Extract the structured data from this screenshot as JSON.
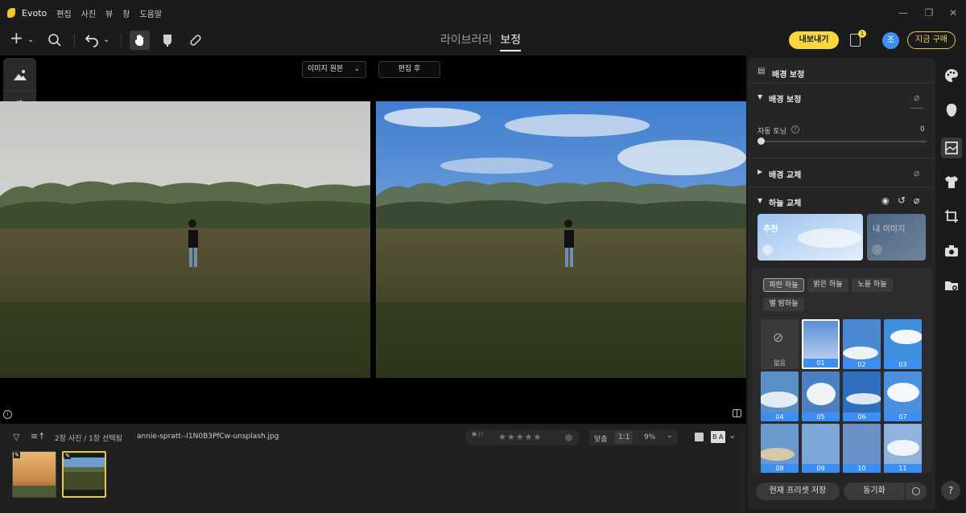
{
  "titlebar": {
    "app_name": "Evoto",
    "menus": [
      "편집",
      "사진",
      "뷰",
      "창",
      "도움말"
    ],
    "window_buttons": [
      "minimize-icon",
      "restore-icon",
      "close-icon"
    ]
  },
  "toolbar": {
    "tabs": {
      "library": "라이브러리",
      "edit": "보정"
    },
    "export_label": "내보내기",
    "notification_count": "1",
    "avatar_initial": "조",
    "buy_label": "지금 구매"
  },
  "canvas": {
    "view_select": "이미지 원본",
    "after_label": "편집 후"
  },
  "filmstrip": {
    "count_text": "2장 사진 / 1장 선택됨",
    "filename": "annie-spratt--l1N0B3PfCw-unsplash.jpg",
    "zoom_fit": "맞춤",
    "zoom_one": "1:1",
    "zoom_percent": "9%",
    "ba_label": "B A"
  },
  "panel": {
    "title": "배경 보정",
    "section_bg": "배경 보정",
    "auto_toning_label": "자동 토닝",
    "auto_toning_value": "0",
    "section_replace": "배경 교체",
    "section_sky": "하늘 교체",
    "sky_cards": {
      "recommended": "추천",
      "mine": "내 이미지"
    },
    "sky_tabs": [
      "파란 하늘",
      "밝은 하늘",
      "노을 하늘",
      "별 밤하늘"
    ],
    "sky_none": "없음",
    "sky_items": [
      "01",
      "02",
      "03",
      "04",
      "05",
      "06",
      "07",
      "08",
      "09",
      "10",
      "11"
    ],
    "save_preset": "현재 프리셋 저장",
    "sync": "동기화"
  },
  "rightrail": {
    "icons": [
      "palette-icon",
      "face-icon",
      "background-icon",
      "clothing-icon",
      "crop-icon",
      "camera-icon",
      "folder-icon",
      "help-icon"
    ],
    "help_label": "?"
  },
  "colors": {
    "accent_yellow": "#f7d843",
    "accent_blue": "#3c8ef3",
    "panel_bg": "#252527"
  }
}
